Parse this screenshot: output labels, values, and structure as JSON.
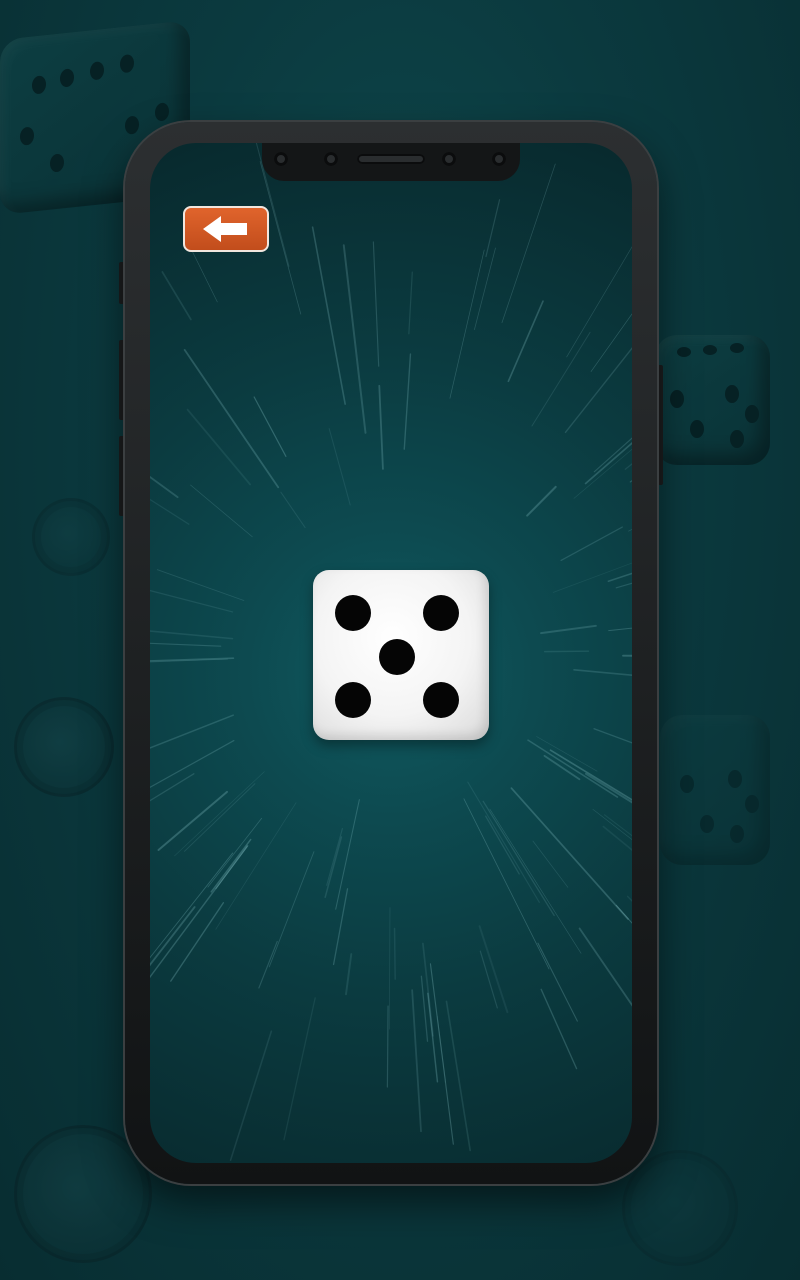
{
  "app": {
    "screen": "dice-roll"
  },
  "back_button": {
    "icon": "arrow-left-icon"
  },
  "dice": {
    "face_value": 5
  },
  "colors": {
    "background": "#0b3a3f",
    "screen_glow": "#0f5a60",
    "back_button": "#d45a24",
    "back_button_border": "#f1e6de",
    "dice_face": "#ffffff",
    "dice_pip": "#050505"
  }
}
